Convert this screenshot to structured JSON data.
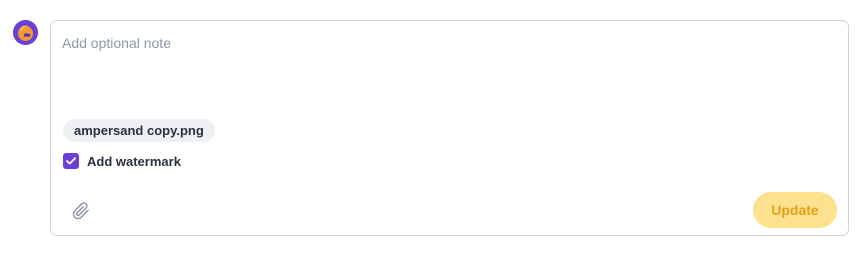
{
  "composer": {
    "note_value": "",
    "note_placeholder": "Add optional note",
    "attachment": {
      "filename": "ampersand copy.png"
    },
    "watermark": {
      "label": "Add watermark",
      "checked": true
    },
    "attach_icon": "paperclip-icon",
    "update_label": "Update"
  },
  "avatar": {
    "icon": "user-avatar"
  },
  "colors": {
    "accent_purple": "#6a3fd8",
    "update_bg": "#fce28e",
    "update_text": "#e6a11b",
    "border": "#cfd3da",
    "placeholder": "#8e97a6"
  }
}
